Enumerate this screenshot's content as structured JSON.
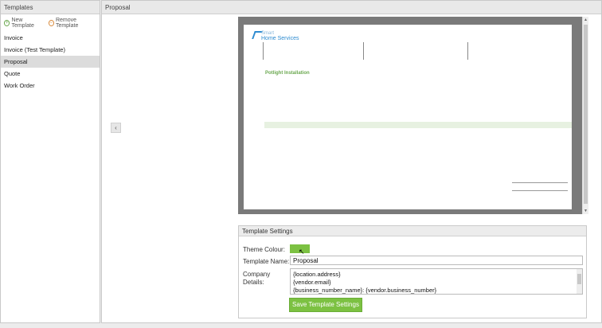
{
  "left_panel": {
    "header": "Templates",
    "new_template": "New Template",
    "remove_template": "Remove Template",
    "templates": [
      "Invoice",
      "Invoice (Test Template)",
      "Proposal",
      "Quote",
      "Work Order"
    ],
    "selected": "Proposal"
  },
  "right_panel": {
    "header": "Proposal",
    "prev_arrow": "‹"
  },
  "preview": {
    "logo_line1": "Smart",
    "logo_line2": "Home Services",
    "title": "Potlight Installation"
  },
  "settings": {
    "header": "Template Settings",
    "theme_colour_label": "Theme Colour:",
    "theme_colour": "#7cc142",
    "template_name_label": "Template Name:",
    "template_name_value": "Proposal",
    "company_details_label": "Company Details:",
    "company_details_lines": [
      "{location.address}",
      "{vendor.email}",
      "{business_number_name}: {vendor.business_number}"
    ],
    "save_button": "Save Template Settings"
  }
}
